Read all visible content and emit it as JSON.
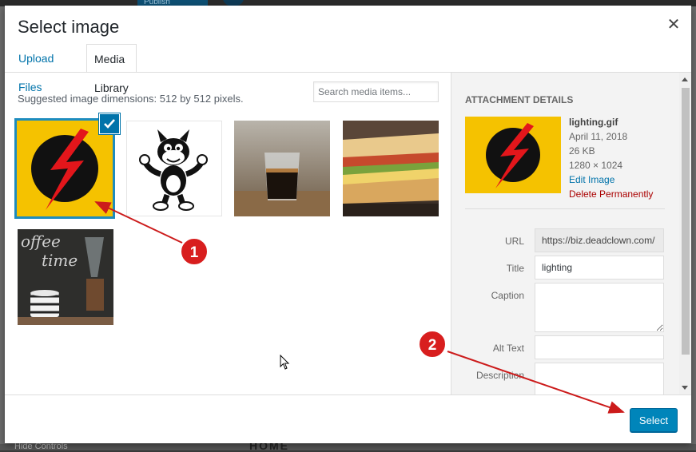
{
  "background": {
    "publish_label": "Publish",
    "hide_controls": "Hide Controls",
    "home": "HOME"
  },
  "modal": {
    "title": "Select image",
    "close_icon": "close-icon"
  },
  "tabs": [
    {
      "label": "Upload Files",
      "active": false
    },
    {
      "label": "Media Library",
      "active": true
    }
  ],
  "library": {
    "suggested": "Suggested image dimensions: 512 by 512 pixels.",
    "search_placeholder": "Search media items...",
    "items": [
      {
        "name": "lighting.gif",
        "selected": true
      },
      {
        "name": "cartoon-cat"
      },
      {
        "name": "espresso-glass"
      },
      {
        "name": "sandwich"
      },
      {
        "name": "coffee-time"
      }
    ]
  },
  "attachment": {
    "heading": "Attachment Details",
    "filename": "lighting.gif",
    "date": "April 11, 2018",
    "size": "26 KB",
    "dimensions": "1280 × 1024",
    "edit_link": "Edit Image",
    "delete_link": "Delete Permanently",
    "fields": {
      "url_label": "URL",
      "url_value": "https://biz.deadclown.com/",
      "title_label": "Title",
      "title_value": "lighting",
      "caption_label": "Caption",
      "caption_value": "",
      "alt_label": "Alt Text",
      "alt_value": "",
      "description_label": "Description",
      "description_value": ""
    }
  },
  "footer": {
    "select_label": "Select"
  },
  "annotations": {
    "step1": "1",
    "step2": "2",
    "arrow_color": "#cc1b1b"
  },
  "colors": {
    "accent": "#0073aa",
    "button": "#0085ba",
    "delete": "#aa0000"
  }
}
